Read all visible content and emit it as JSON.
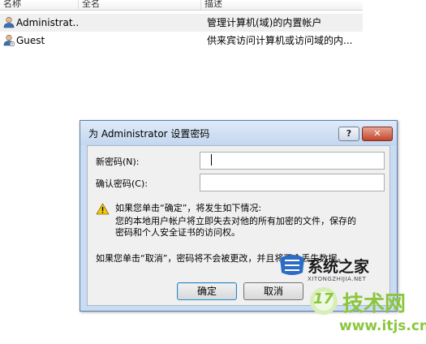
{
  "list": {
    "headers": [
      "名称",
      "全名",
      "描述"
    ],
    "rows": [
      {
        "name": "Administrat...",
        "full_name": "",
        "description": "管理计算机(域)的内置帐户"
      },
      {
        "name": "Guest",
        "full_name": "",
        "description": "供来宾访问计算机或访问域的内..."
      }
    ]
  },
  "dialog": {
    "title": "为 Administrator 设置密码",
    "help_label": "?",
    "close_label": "✕",
    "new_password_label": "新密码(N):",
    "new_password_value": "",
    "confirm_password_label": "确认密码(C):",
    "confirm_password_value": "",
    "warning_heading": "如果您单击“确定”，将发生如下情况:",
    "warning_line1": "您的本地用户帐户将立即失去对他的所有加密的文件，保存的",
    "warning_line2": "密码和个人安全证书的访问权。",
    "cancel_note": "如果您单击“取消”，密码将不会被更改，并且将不会丢失数据。",
    "ok_label": "确定",
    "cancel_label": "取消"
  },
  "watermarks": {
    "site1_name": "系统之家",
    "site1_url": "XITONGZHIJIA.NET",
    "site2_name": "技术网",
    "site2_num": "17",
    "site2_url": "www.itjs.cn"
  },
  "colors": {
    "title_bar": "#c9dcf2",
    "close_button": "#c3452c",
    "warning": "#f2c811",
    "watermark_green": "#8cc63f"
  }
}
